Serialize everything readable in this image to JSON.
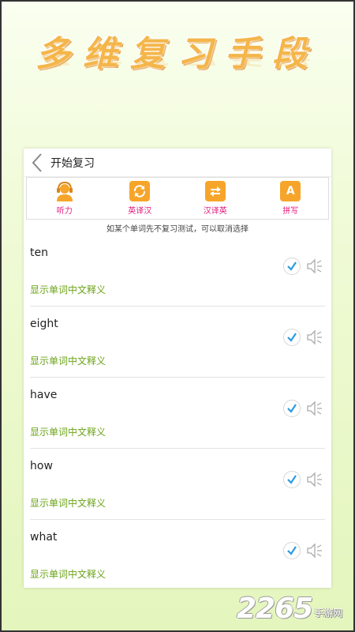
{
  "promo": {
    "title": "多维复习手段"
  },
  "header": {
    "title": "开始复习"
  },
  "modes": [
    {
      "label": "听力",
      "icon": "headset-person-icon"
    },
    {
      "label": "英译汉",
      "icon": "sync-icon"
    },
    {
      "label": "汉译英",
      "icon": "swap-icon"
    },
    {
      "label": "拼写",
      "icon": "spell-a-icon",
      "glyph": "A"
    }
  ],
  "hint": "如某个单词先不复习测试，可以取消选择",
  "words": [
    {
      "word": "ten",
      "show_meaning": "显示单词中文释义",
      "checked": true
    },
    {
      "word": "eight",
      "show_meaning": "显示单词中文释义",
      "checked": true
    },
    {
      "word": "have",
      "show_meaning": "显示单词中文释义",
      "checked": true
    },
    {
      "word": "how",
      "show_meaning": "显示单词中文释义",
      "checked": true
    },
    {
      "word": "what",
      "show_meaning": "显示单词中文释义",
      "checked": true
    }
  ],
  "watermark": {
    "number": "2265",
    "text": "手游网"
  },
  "colors": {
    "accent_orange": "#f6a52a",
    "mode_label": "#e2187b",
    "meaning_green": "#6ba317",
    "check_blue": "#2a9be0"
  }
}
